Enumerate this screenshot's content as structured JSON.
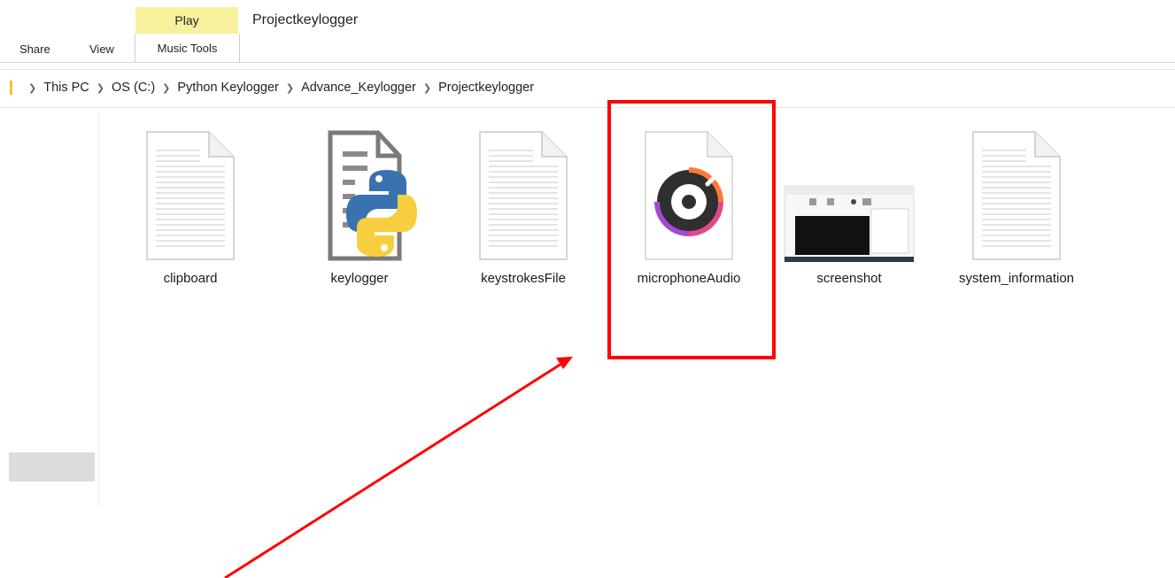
{
  "ribbon": {
    "context_tab": "Play",
    "window_title": "Projectkeylogger",
    "tabs": [
      "Share",
      "View",
      "Music Tools"
    ]
  },
  "address_bar": {
    "crumbs": [
      "This PC",
      "OS (C:)",
      "Python Keylogger",
      "Advance_Keylogger",
      "Projectkeylogger"
    ]
  },
  "files": [
    {
      "name": "clipboard",
      "icon": "text-file-icon"
    },
    {
      "name": "keylogger",
      "icon": "python-file-icon"
    },
    {
      "name": "keystrokesFile",
      "icon": "text-file-icon"
    },
    {
      "name": "microphoneAudio",
      "icon": "audio-file-icon"
    },
    {
      "name": "screenshot",
      "icon": "image-thumbnail-icon"
    },
    {
      "name": "system_information",
      "icon": "text-file-icon"
    }
  ],
  "annotation": {
    "color": "#ff0000",
    "target": "microphoneAudio"
  },
  "colors": {
    "context_tab_bg": "#f7f19e",
    "folder_accent": "#f0c233"
  }
}
